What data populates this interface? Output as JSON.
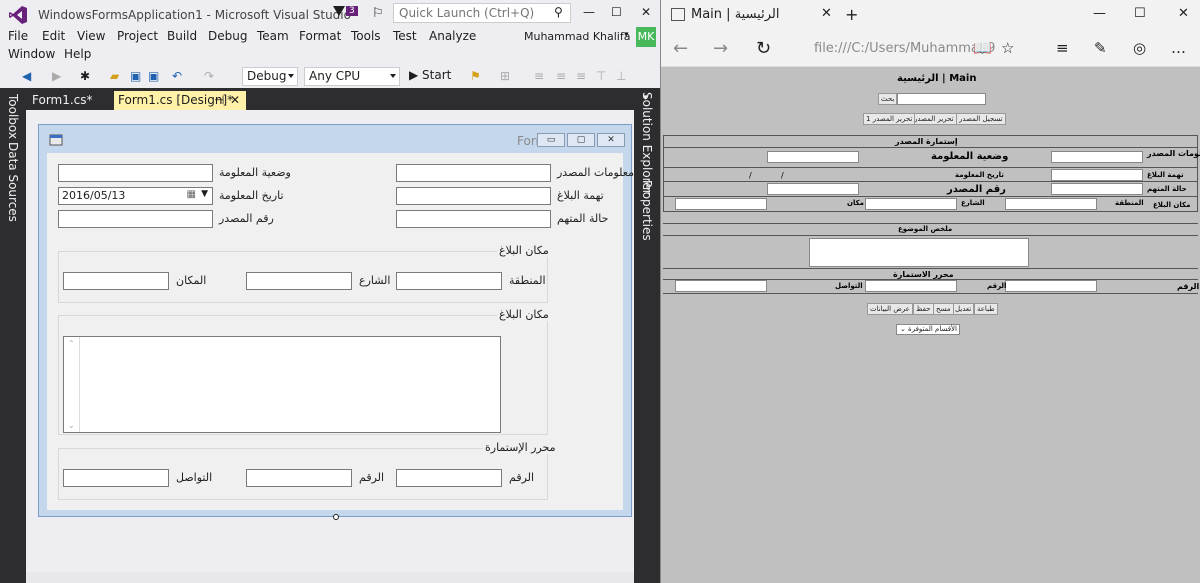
{
  "vs": {
    "title": "WindowsFormsApplication1 - Microsoft Visual Studio",
    "notif_count": "3",
    "quick_launch_placeholder": "Quick Launch (Ctrl+Q)",
    "win_min": "—",
    "win_max": "☐",
    "win_close": "✕",
    "menu": [
      "File",
      "Edit",
      "View",
      "Project",
      "Build",
      "Debug",
      "Team",
      "Format",
      "Tools",
      "Test",
      "Analyze",
      "Window",
      "Help"
    ],
    "user_name": "Muhammad Khalifa",
    "user_initials": "MK",
    "config": "Debug",
    "platform": "Any CPU",
    "start_label": "▶ Start",
    "left_rail": [
      "Toolbox",
      "Data Sources"
    ],
    "right_rail": [
      "Solution Explorer",
      "Properties"
    ],
    "tabs": [
      {
        "label": "Form1.cs*"
      },
      {
        "label": "Form1.cs [Design]*"
      }
    ],
    "tab_pin": "⊣",
    "tab_close": "✕"
  },
  "form": {
    "title": "Form1",
    "btn_min": "▭",
    "btn_max": "▢",
    "btn_close": "✕",
    "labels": {
      "source_info": "معلومات المصدر",
      "info_status": "وضعية المعلومة",
      "report_charge": "تهمة البلاغ",
      "info_date": "تاريخ المعلومة",
      "accused_status": "حالة المتهم",
      "source_number": "رقم المصدر"
    },
    "date_value": "2016/05/13",
    "group_location": {
      "title": "مكان البلاغ",
      "region": "المنطقة",
      "street": "الشارع",
      "place": "المكان"
    },
    "group_subject": {
      "title": "مكان البلاغ"
    },
    "group_editor": {
      "title": "محرر الإستمارة",
      "number1": "الرقم",
      "number2": "الرقم",
      "contact": "التواصل"
    }
  },
  "edge": {
    "tab_title": "Main | الرئيسية",
    "url": "file:///C:/Users/Muhammad9",
    "new_tab": "+",
    "win_min": "—",
    "win_max": "☐",
    "win_close": "✕",
    "back": "←",
    "forward": "→",
    "refresh": "↻",
    "reading_icon": "📖",
    "favorite_icon": "☆",
    "hub_icon": "≡",
    "note_icon": "✎",
    "share_icon": "◎",
    "more_icon": "…",
    "page": {
      "heading": "Main | الرئيسية",
      "search_btn": "بحث",
      "btn_register_source": "تسجيل المصدر",
      "btn_edit_source": "تحرير المصدر",
      "btn_edit_source_1": "تحرير المصدر 1",
      "form_header": "إستمارة المصدر",
      "lbl_source_info": "معلومات المصدر",
      "lbl_info_status": "وضعية المعلومة",
      "lbl_report_charge": "تهمة البلاغ",
      "lbl_info_date": "تاريخ المعلومة",
      "date_sep1": "/",
      "date_sep2": "/",
      "lbl_accused_status": "حالة المتهم",
      "lbl_source_number": "رقم المصدر",
      "lbl_report_place": "مكان البلاغ",
      "lbl_region": "المنطقة",
      "lbl_street": "الشارع",
      "lbl_place": "مكان",
      "summary_header": "ملخص الموضوع",
      "editor_header": "محرر الاستمارة",
      "lbl_number": "الرقم",
      "lbl_number2": "الرقم",
      "lbl_contact": "التواصل",
      "btn_print": "طباعة",
      "btn_modify": "تعديل",
      "btn_clear": "مسح",
      "btn_save": "حفظ",
      "btn_show": "عرض البيانات",
      "select_value": "الأقسام المتوفرة"
    }
  }
}
